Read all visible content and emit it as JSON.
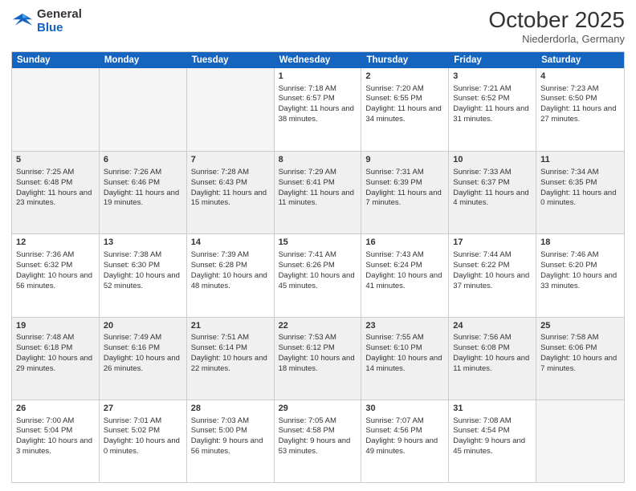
{
  "header": {
    "logo_general": "General",
    "logo_blue": "Blue",
    "month": "October 2025",
    "location": "Niederdorla, Germany"
  },
  "weekdays": [
    "Sunday",
    "Monday",
    "Tuesday",
    "Wednesday",
    "Thursday",
    "Friday",
    "Saturday"
  ],
  "rows": [
    [
      {
        "day": "",
        "info": "",
        "empty": true
      },
      {
        "day": "",
        "info": "",
        "empty": true
      },
      {
        "day": "",
        "info": "",
        "empty": true
      },
      {
        "day": "1",
        "info": "Sunrise: 7:18 AM\nSunset: 6:57 PM\nDaylight: 11 hours and 38 minutes."
      },
      {
        "day": "2",
        "info": "Sunrise: 7:20 AM\nSunset: 6:55 PM\nDaylight: 11 hours and 34 minutes."
      },
      {
        "day": "3",
        "info": "Sunrise: 7:21 AM\nSunset: 6:52 PM\nDaylight: 11 hours and 31 minutes."
      },
      {
        "day": "4",
        "info": "Sunrise: 7:23 AM\nSunset: 6:50 PM\nDaylight: 11 hours and 27 minutes."
      }
    ],
    [
      {
        "day": "5",
        "info": "Sunrise: 7:25 AM\nSunset: 6:48 PM\nDaylight: 11 hours and 23 minutes.",
        "shaded": true
      },
      {
        "day": "6",
        "info": "Sunrise: 7:26 AM\nSunset: 6:46 PM\nDaylight: 11 hours and 19 minutes.",
        "shaded": true
      },
      {
        "day": "7",
        "info": "Sunrise: 7:28 AM\nSunset: 6:43 PM\nDaylight: 11 hours and 15 minutes.",
        "shaded": true
      },
      {
        "day": "8",
        "info": "Sunrise: 7:29 AM\nSunset: 6:41 PM\nDaylight: 11 hours and 11 minutes.",
        "shaded": true
      },
      {
        "day": "9",
        "info": "Sunrise: 7:31 AM\nSunset: 6:39 PM\nDaylight: 11 hours and 7 minutes.",
        "shaded": true
      },
      {
        "day": "10",
        "info": "Sunrise: 7:33 AM\nSunset: 6:37 PM\nDaylight: 11 hours and 4 minutes.",
        "shaded": true
      },
      {
        "day": "11",
        "info": "Sunrise: 7:34 AM\nSunset: 6:35 PM\nDaylight: 11 hours and 0 minutes.",
        "shaded": true
      }
    ],
    [
      {
        "day": "12",
        "info": "Sunrise: 7:36 AM\nSunset: 6:32 PM\nDaylight: 10 hours and 56 minutes."
      },
      {
        "day": "13",
        "info": "Sunrise: 7:38 AM\nSunset: 6:30 PM\nDaylight: 10 hours and 52 minutes."
      },
      {
        "day": "14",
        "info": "Sunrise: 7:39 AM\nSunset: 6:28 PM\nDaylight: 10 hours and 48 minutes."
      },
      {
        "day": "15",
        "info": "Sunrise: 7:41 AM\nSunset: 6:26 PM\nDaylight: 10 hours and 45 minutes."
      },
      {
        "day": "16",
        "info": "Sunrise: 7:43 AM\nSunset: 6:24 PM\nDaylight: 10 hours and 41 minutes."
      },
      {
        "day": "17",
        "info": "Sunrise: 7:44 AM\nSunset: 6:22 PM\nDaylight: 10 hours and 37 minutes."
      },
      {
        "day": "18",
        "info": "Sunrise: 7:46 AM\nSunset: 6:20 PM\nDaylight: 10 hours and 33 minutes."
      }
    ],
    [
      {
        "day": "19",
        "info": "Sunrise: 7:48 AM\nSunset: 6:18 PM\nDaylight: 10 hours and 29 minutes.",
        "shaded": true
      },
      {
        "day": "20",
        "info": "Sunrise: 7:49 AM\nSunset: 6:16 PM\nDaylight: 10 hours and 26 minutes.",
        "shaded": true
      },
      {
        "day": "21",
        "info": "Sunrise: 7:51 AM\nSunset: 6:14 PM\nDaylight: 10 hours and 22 minutes.",
        "shaded": true
      },
      {
        "day": "22",
        "info": "Sunrise: 7:53 AM\nSunset: 6:12 PM\nDaylight: 10 hours and 18 minutes.",
        "shaded": true
      },
      {
        "day": "23",
        "info": "Sunrise: 7:55 AM\nSunset: 6:10 PM\nDaylight: 10 hours and 14 minutes.",
        "shaded": true
      },
      {
        "day": "24",
        "info": "Sunrise: 7:56 AM\nSunset: 6:08 PM\nDaylight: 10 hours and 11 minutes.",
        "shaded": true
      },
      {
        "day": "25",
        "info": "Sunrise: 7:58 AM\nSunset: 6:06 PM\nDaylight: 10 hours and 7 minutes.",
        "shaded": true
      }
    ],
    [
      {
        "day": "26",
        "info": "Sunrise: 7:00 AM\nSunset: 5:04 PM\nDaylight: 10 hours and 3 minutes."
      },
      {
        "day": "27",
        "info": "Sunrise: 7:01 AM\nSunset: 5:02 PM\nDaylight: 10 hours and 0 minutes."
      },
      {
        "day": "28",
        "info": "Sunrise: 7:03 AM\nSunset: 5:00 PM\nDaylight: 9 hours and 56 minutes."
      },
      {
        "day": "29",
        "info": "Sunrise: 7:05 AM\nSunset: 4:58 PM\nDaylight: 9 hours and 53 minutes."
      },
      {
        "day": "30",
        "info": "Sunrise: 7:07 AM\nSunset: 4:56 PM\nDaylight: 9 hours and 49 minutes."
      },
      {
        "day": "31",
        "info": "Sunrise: 7:08 AM\nSunset: 4:54 PM\nDaylight: 9 hours and 45 minutes."
      },
      {
        "day": "",
        "info": "",
        "empty": true
      }
    ]
  ]
}
